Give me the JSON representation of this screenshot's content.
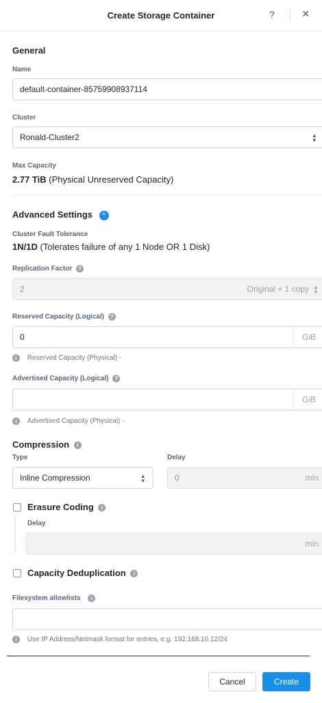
{
  "header": {
    "title": "Create Storage Container",
    "help_label": "?",
    "close_label": "×"
  },
  "general": {
    "title": "General",
    "name_label": "Name",
    "name_value": "default-container-85759908937114",
    "cluster_label": "Cluster",
    "cluster_value": "Ronald-Cluster2",
    "max_capacity_label": "Max Capacity",
    "max_capacity_value": "2.77 TiB",
    "max_capacity_desc": "(Physical Unreserved Capacity)"
  },
  "advanced": {
    "title": "Advanced Settings",
    "fault_tolerance_label": "Cluster Fault Tolerance",
    "fault_tolerance_value": "1N/1D",
    "fault_tolerance_desc": "(Tolerates failure of any 1 Node OR 1 Disk)",
    "replication_label": "Replication Factor",
    "replication_value": "2",
    "replication_suffix": "Original + 1 copy",
    "reserved_label": "Reserved Capacity (Logical)",
    "reserved_value": "0",
    "reserved_unit": "GiB",
    "reserved_physical_hint": "Reserved Capacity (Physical) -",
    "advertised_label": "Advertised Capacity (Logical)",
    "advertised_value": "",
    "advertised_unit": "GiB",
    "advertised_physical_hint": "Advertised Capacity (Physical) -"
  },
  "compression": {
    "title": "Compression",
    "type_label": "Type",
    "type_value": "Inline Compression",
    "delay_label": "Delay",
    "delay_value": "0",
    "delay_unit": "min"
  },
  "erasure": {
    "label": "Erasure Coding",
    "checked": false,
    "delay_label": "Delay",
    "delay_value": "",
    "delay_unit": "min"
  },
  "dedup": {
    "label": "Capacity Deduplication",
    "checked": false
  },
  "filesystem": {
    "label": "Filesystem allowlists",
    "value": "",
    "hint": "Use IP Address/Netmask format for entries, e.g. 192.168.10.12/24"
  },
  "footer": {
    "cancel_label": "Cancel",
    "create_label": "Create"
  },
  "colors": {
    "primary": "#1a8fe6",
    "text": "#22272e",
    "muted": "#5b6675"
  }
}
